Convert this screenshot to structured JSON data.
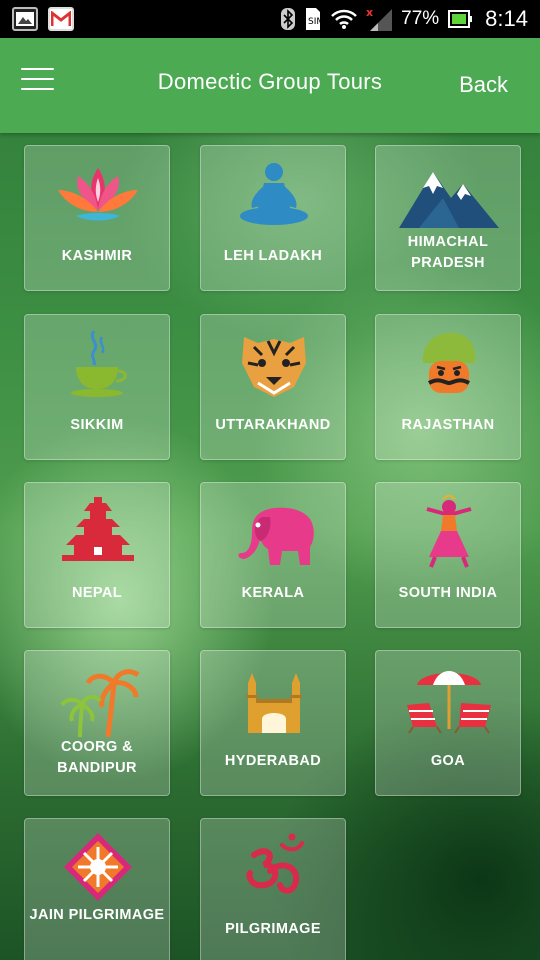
{
  "status_bar": {
    "battery_percent": "77%",
    "time": "8:14",
    "icons": [
      "gallery-icon",
      "gmail-icon",
      "bluetooth-icon",
      "sim-icon",
      "wifi-icon",
      "signal-icon",
      "battery-icon"
    ]
  },
  "header": {
    "title": "Domectic Group Tours",
    "back_label": "Back",
    "menu_icon": "hamburger-menu-icon",
    "color": "#4caa52"
  },
  "tiles": [
    {
      "label": "KASHMIR",
      "icon": "lotus-icon"
    },
    {
      "label": "LEH LADAKH",
      "icon": "meditation-icon"
    },
    {
      "label": "HIMACHAL PRADESH",
      "icon": "mountain-icon"
    },
    {
      "label": "SIKKIM",
      "icon": "tea-cup-icon"
    },
    {
      "label": "UTTARAKHAND",
      "icon": "tiger-icon"
    },
    {
      "label": "RAJASTHAN",
      "icon": "turban-man-icon"
    },
    {
      "label": "NEPAL",
      "icon": "temple-icon"
    },
    {
      "label": "KERALA",
      "icon": "elephant-icon"
    },
    {
      "label": "SOUTH INDIA",
      "icon": "dancer-icon"
    },
    {
      "label": "COORG & BANDIPUR",
      "icon": "palm-tree-icon"
    },
    {
      "label": "HYDERABAD",
      "icon": "charminar-icon"
    },
    {
      "label": "GOA",
      "icon": "beach-chairs-icon"
    },
    {
      "label": "JAIN PILGRIMAGE",
      "icon": "jain-symbol-icon"
    },
    {
      "label": "PILGRIMAGE",
      "icon": "om-icon"
    }
  ]
}
